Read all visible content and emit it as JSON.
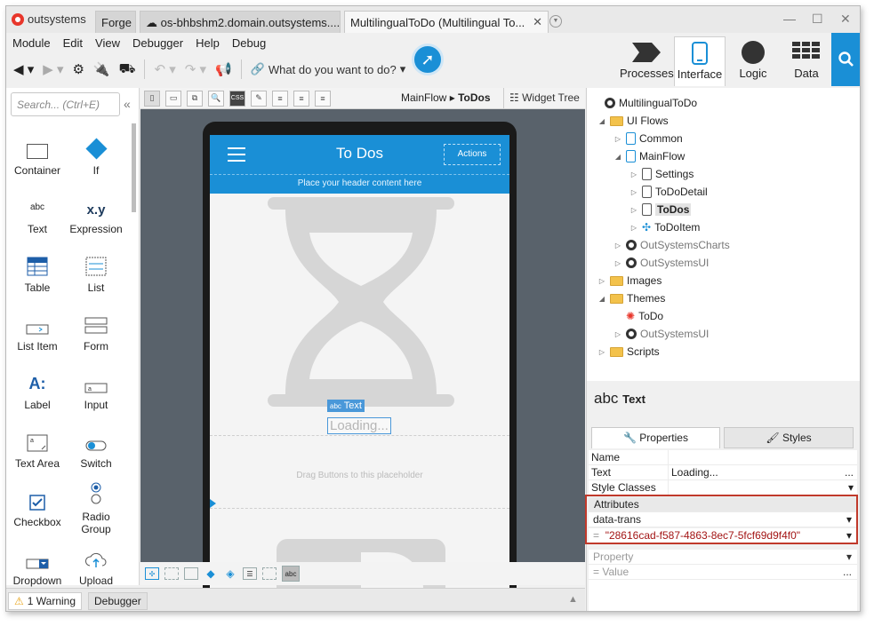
{
  "app": {
    "brand": "outsystems",
    "tabs": [
      "Forge",
      "os-bhbshm2.domain.outsystems....",
      "MultilingualToDo (Multilingual To..."
    ]
  },
  "menu": [
    "Module",
    "Edit",
    "View",
    "Debugger",
    "Help",
    "Debug"
  ],
  "toolbar": {
    "search_placeholder": "What do you want to do?"
  },
  "main_tabs": [
    "Processes",
    "Interface",
    "Logic",
    "Data"
  ],
  "toolbox": {
    "search_placeholder": "Search... (Ctrl+E)",
    "items": [
      {
        "label": "Container",
        "icon": "container-icon"
      },
      {
        "label": "If",
        "icon": "if-icon"
      },
      {
        "label": "Text",
        "icon": "text-icon"
      },
      {
        "label": "Expression",
        "icon": "expression-icon"
      },
      {
        "label": "Table",
        "icon": "table-icon"
      },
      {
        "label": "List",
        "icon": "list-icon"
      },
      {
        "label": "List Item",
        "icon": "list-item-icon"
      },
      {
        "label": "Form",
        "icon": "form-icon"
      },
      {
        "label": "Label",
        "icon": "label-icon"
      },
      {
        "label": "Input",
        "icon": "input-icon"
      },
      {
        "label": "Text Area",
        "icon": "text-area-icon"
      },
      {
        "label": "Switch",
        "icon": "switch-icon"
      },
      {
        "label": "Checkbox",
        "icon": "checkbox-icon"
      },
      {
        "label": "Radio Group",
        "icon": "radio-group-icon"
      },
      {
        "label": "Dropdown",
        "icon": "dropdown-icon"
      },
      {
        "label": "Upload",
        "icon": "upload-icon"
      }
    ],
    "text_glyph": "abc",
    "expr_glyph": "x.y",
    "label_glyph": "A:"
  },
  "canvas": {
    "breadcrumb_parent": "MainFlow",
    "breadcrumb_current": "ToDos",
    "widget_tree": "Widget Tree",
    "screen_title": "To Dos",
    "actions_label": "Actions",
    "header_placeholder": "Place your header content here",
    "selected_widget": "Text",
    "loading_text": "Loading...",
    "buttons_placeholder": "Drag Buttons to this placeholder"
  },
  "tree": [
    {
      "label": "MultilingualToDo",
      "level": 0,
      "kind": "module",
      "twisty": ""
    },
    {
      "label": "UI Flows",
      "level": 1,
      "kind": "folder",
      "twisty": "◢"
    },
    {
      "label": "Common",
      "level": 2,
      "kind": "flow",
      "twisty": "▷"
    },
    {
      "label": "MainFlow",
      "level": 2,
      "kind": "flow",
      "twisty": "◢"
    },
    {
      "label": "Settings",
      "level": 3,
      "kind": "page",
      "twisty": "▷"
    },
    {
      "label": "ToDoDetail",
      "level": 3,
      "kind": "page",
      "twisty": "▷"
    },
    {
      "label": "ToDos",
      "level": 3,
      "kind": "page",
      "twisty": "▷",
      "selected": true
    },
    {
      "label": "ToDoItem",
      "level": 3,
      "kind": "block",
      "twisty": "▷"
    },
    {
      "label": "OutSystemsCharts",
      "level": 2,
      "kind": "module-ref",
      "twisty": "▷"
    },
    {
      "label": "OutSystemsUI",
      "level": 2,
      "kind": "module-ref",
      "twisty": "▷"
    },
    {
      "label": "Images",
      "level": 1,
      "kind": "folder",
      "twisty": "▷"
    },
    {
      "label": "Themes",
      "level": 1,
      "kind": "folder",
      "twisty": "◢"
    },
    {
      "label": "ToDo",
      "level": 2,
      "kind": "theme",
      "twisty": ""
    },
    {
      "label": "OutSystemsUI",
      "level": 2,
      "kind": "module-ref",
      "twisty": "▷"
    },
    {
      "label": "Scripts",
      "level": 1,
      "kind": "folder",
      "twisty": "▷"
    }
  ],
  "properties": {
    "type_glyph": "abc",
    "type_name": "Text",
    "tab_properties": "Properties",
    "tab_styles": "Styles",
    "rows": [
      {
        "k": "Name",
        "v": ""
      },
      {
        "k": "Text",
        "v": "Loading..."
      },
      {
        "k": "Style Classes",
        "v": ""
      }
    ],
    "attributes_label": "Attributes",
    "attr_name": "data-trans",
    "attr_eq": "=",
    "attr_value": "\"28616cad-f587-4863-8ec7-5fcf69d9f4f0\"",
    "new_property": "Property",
    "new_value": "= Value",
    "ellipsis": "..."
  },
  "status": {
    "warnings": "1 Warning",
    "debugger": "Debugger"
  }
}
